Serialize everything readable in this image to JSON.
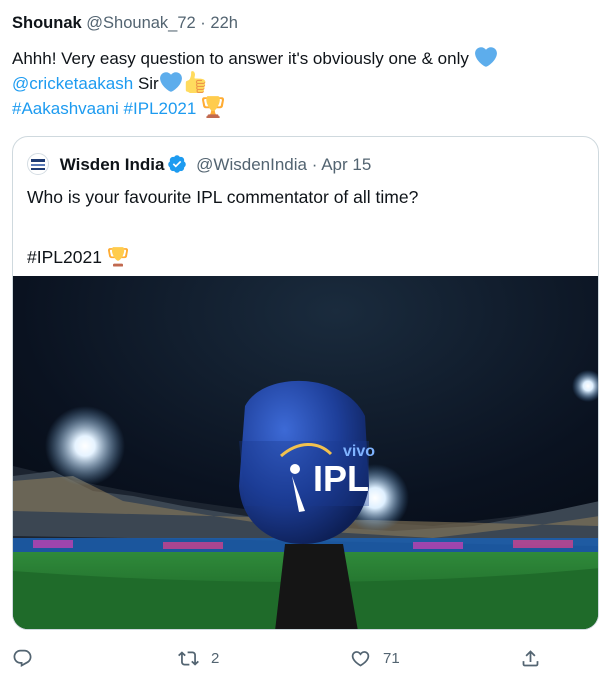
{
  "tweet": {
    "author_name": "Shounak",
    "author_handle": "@Shounak_72",
    "separator": "·",
    "time": "22h",
    "line1": "Ahhh! Very easy question to answer it's obviously one & only",
    "mention": "@cricketaakash",
    "line2_suffix": "Sir",
    "hashtag1": "#Aakashvaani",
    "hashtag2": "#IPL2021",
    "emojis": [
      "blue-heart",
      "blue-heart",
      "thumbs-up",
      "trophy"
    ]
  },
  "quoted": {
    "author_name": "Wisden India",
    "author_handle": "@WisdenIndia",
    "separator": "·",
    "date": "Apr 15",
    "text": "Who is your favourite IPL commentator of all time?",
    "hashtag": "#IPL2021",
    "image_text_mic": "IPL",
    "image_text_sponsor": "vivo"
  },
  "actions": {
    "reply_count": "",
    "retweet_count": "2",
    "like_count": "71"
  },
  "colors": {
    "link": "#1d9bf0",
    "muted": "#536471",
    "border": "#cfd9de",
    "mic": "#1e3f9a"
  }
}
